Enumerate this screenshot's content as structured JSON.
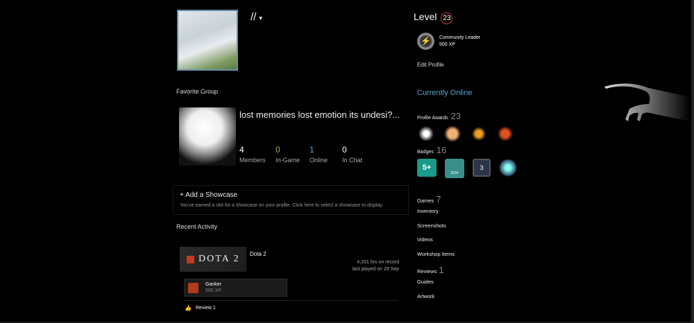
{
  "profile": {
    "name": "//",
    "caret": "▾"
  },
  "favorite_group": {
    "label": "Favorite Group",
    "name": "lost memories lost emotion its undesi?...",
    "stats": [
      {
        "n": "4",
        "l": "Members",
        "color": "#ffffff"
      },
      {
        "n": "0",
        "l": "In-Game",
        "color": "#8fb75b"
      },
      {
        "n": "1",
        "l": "Online",
        "color": "#57a6cc"
      },
      {
        "n": "0",
        "l": "In Chat",
        "color": "#ffffff"
      }
    ]
  },
  "showcase": {
    "title": "+ Add a Showcase",
    "desc": "You've earned a slot for a showcase on your profile. Click here to select a showcase to display."
  },
  "recent": {
    "label": "Recent Activity",
    "game_logo": "DOTA 2",
    "game": "Dota 2",
    "hours": "4,331 hrs on record",
    "last_played": "last played on 29 Sep",
    "achievement": {
      "name": "Ganker",
      "xp": "500 XP"
    },
    "review": "Review 1"
  },
  "sidebar": {
    "level_label": "Level",
    "level": "23",
    "badge_name": "Community Leader",
    "badge_xp": "500 XP",
    "edit": "Edit Profile",
    "status": "Currently Online",
    "awards_label": "Profile Awards",
    "awards_count": "23",
    "badges_label": "Badges",
    "badges_count": "16",
    "badge3": "3",
    "badge1": "5+",
    "badge2": "2024",
    "links": [
      {
        "label": "Games",
        "count": "7"
      },
      {
        "label": "Inventory",
        "count": ""
      },
      {
        "label": "Screenshots",
        "count": ""
      },
      {
        "label": "Videos",
        "count": ""
      },
      {
        "label": "Workshop Items",
        "count": ""
      },
      {
        "label": "Reviews",
        "count": "1"
      },
      {
        "label": "Guides",
        "count": ""
      },
      {
        "label": "Artwork",
        "count": ""
      }
    ]
  }
}
